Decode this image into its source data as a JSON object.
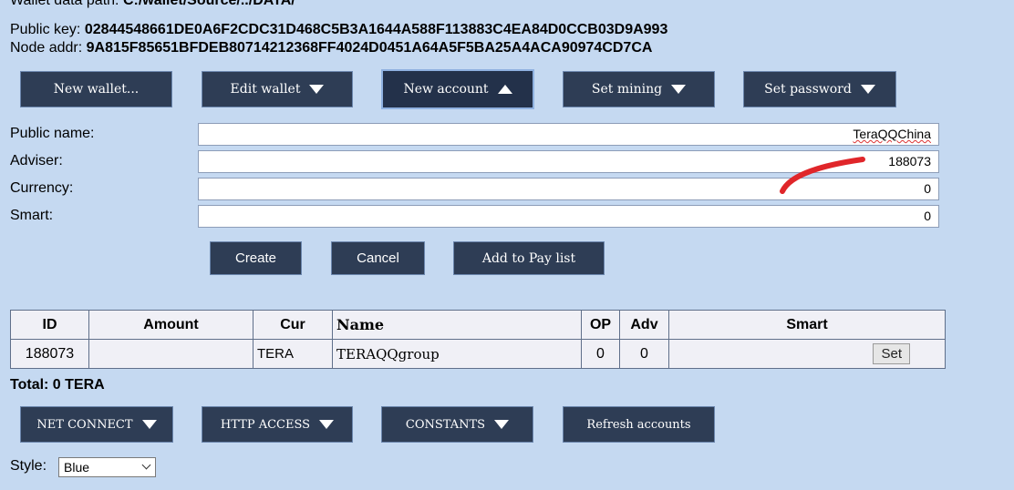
{
  "info": {
    "wallet_path_label": "Wallet data path:",
    "wallet_path_value": "C:/wallet/Source/../DATA/",
    "public_key_label": "Public key:",
    "public_key_value": "02844548661DE0A6F2CDC31D468C5B3A1644A588F113883C4EA84D0CCB03D9A993",
    "node_addr_label": "Node addr:",
    "node_addr_value": "9A815F85651BFDEB80714212368FF4024D0451A64A5F5BA25A4ACA90974CD7CA"
  },
  "toolbar": {
    "new_wallet": "New wallet...",
    "edit_wallet": "Edit wallet",
    "new_account": "New account",
    "set_mining": "Set mining",
    "set_password": "Set password"
  },
  "form": {
    "public_name_label": "Public name:",
    "public_name_value": "TeraQQChina",
    "adviser_label": "Adviser:",
    "adviser_value": "188073",
    "currency_label": "Currency:",
    "currency_value": "0",
    "smart_label": "Smart:",
    "smart_value": "0",
    "create": "Create",
    "cancel": "Cancel",
    "add_to_pay_list": "Add to Pay list"
  },
  "table": {
    "headers": [
      "ID",
      "Amount",
      "Cur",
      "Name",
      "OP",
      "Adv",
      "Smart"
    ],
    "rows": [
      {
        "id": "188073",
        "amount": "",
        "cur": "TERA",
        "name": "TERAQQgroup",
        "op": "0",
        "adv": "0",
        "smart_button": "Set"
      }
    ]
  },
  "total": "Total: 0 TERA",
  "bottom_toolbar": {
    "net_connect": "NET CONNECT",
    "http_access": "HTTP ACCESS",
    "constants": "CONSTANTS",
    "refresh_accounts": "Refresh accounts"
  },
  "style": {
    "label": "Style:",
    "selected": "Blue"
  },
  "colors": {
    "background": "#c5d9f1",
    "button": "#2e3d55",
    "annotation": "#e0262a"
  }
}
